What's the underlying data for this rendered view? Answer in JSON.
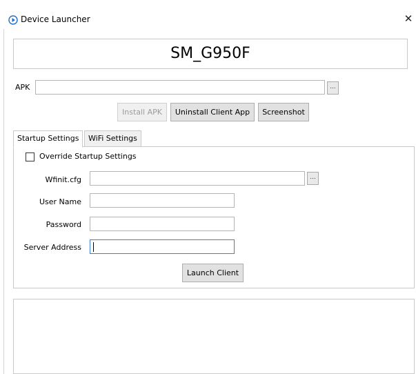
{
  "window": {
    "title": "Device Launcher",
    "title_icon": "play-circle-icon",
    "close_glyph": "✕"
  },
  "device": {
    "name": "SM_G950F"
  },
  "apk": {
    "label": "APK",
    "value": "",
    "browse_label": "..."
  },
  "actions": {
    "install_label": "Install APK",
    "uninstall_label": "Uninstall Client App",
    "screenshot_label": "Screenshot"
  },
  "tabs": [
    {
      "label": "Startup Settings",
      "active": true
    },
    {
      "label": "WiFi Settings",
      "active": false
    }
  ],
  "startup": {
    "override_label": "Override Startup Settings",
    "override_checked": false,
    "wfinit_label": "Wfinit.cfg",
    "wfinit_value": "",
    "wfinit_browse_label": "...",
    "username_label": "User Name",
    "username_value": "",
    "password_label": "Password",
    "password_value": "",
    "server_label": "Server Address",
    "server_value": "",
    "launch_label": "Launch Client"
  },
  "colors": {
    "accent": "#1e6fcc",
    "focus_border": "#3c7fd1"
  },
  "log": {
    "text": ""
  }
}
